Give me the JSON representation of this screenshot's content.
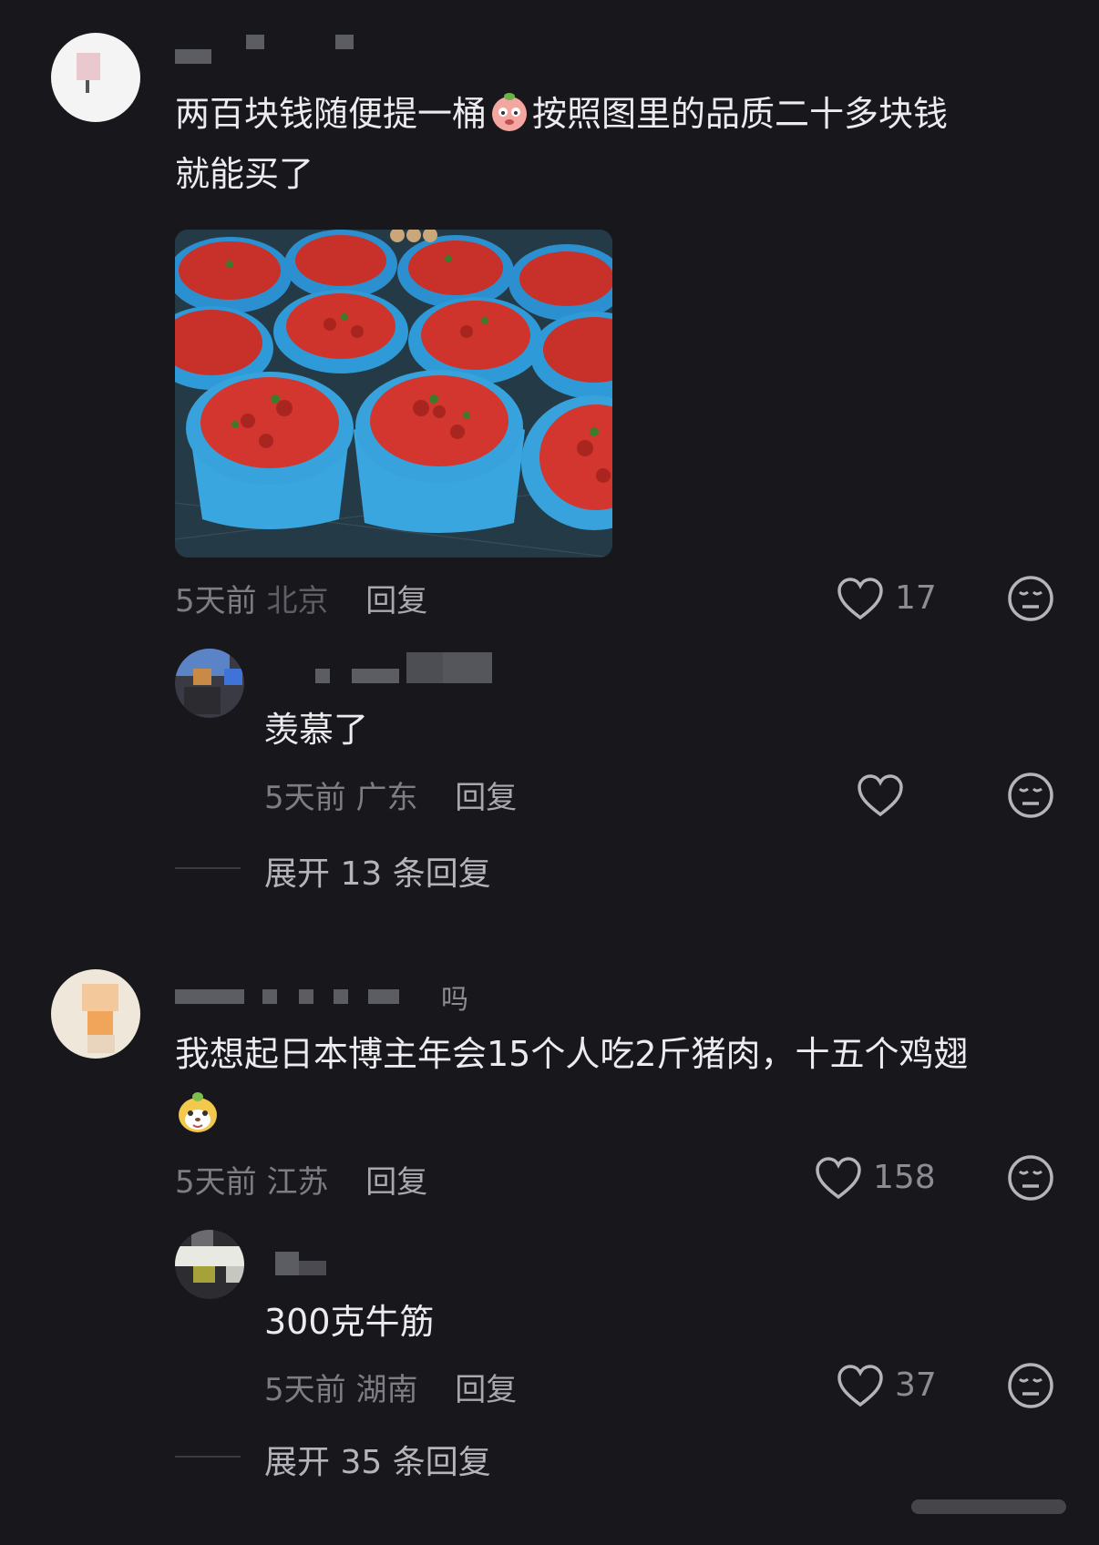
{
  "comments": [
    {
      "text_line1": "两百块钱随便提一桶",
      "text_line1b": "按照图里的品质二十多块钱",
      "text_line2": "就能买了",
      "time": "5天前",
      "location": "北京",
      "reply_label": "回复",
      "likes": "17",
      "image_desc_icon": "strawberry-buckets-photo",
      "reply": {
        "text": "羡慕了",
        "time": "5天前",
        "location": "广东",
        "reply_label": "回复",
        "likes": ""
      },
      "expand_label": "展开 13 条回复"
    },
    {
      "username_suffix": "吗",
      "text_line1": "我想起日本博主年会15个人吃2斤猪肉，十五个鸡翅",
      "time": "5天前",
      "location": "江苏",
      "reply_label": "回复",
      "likes": "158",
      "reply": {
        "text": "300克牛筋",
        "time": "5天前",
        "location": "湖南",
        "reply_label": "回复",
        "likes": "37"
      },
      "expand_label": "展开 35 条回复"
    }
  ],
  "colors": {
    "background": "#17171c",
    "text": "#ececef",
    "meta": "#7d7d84"
  }
}
